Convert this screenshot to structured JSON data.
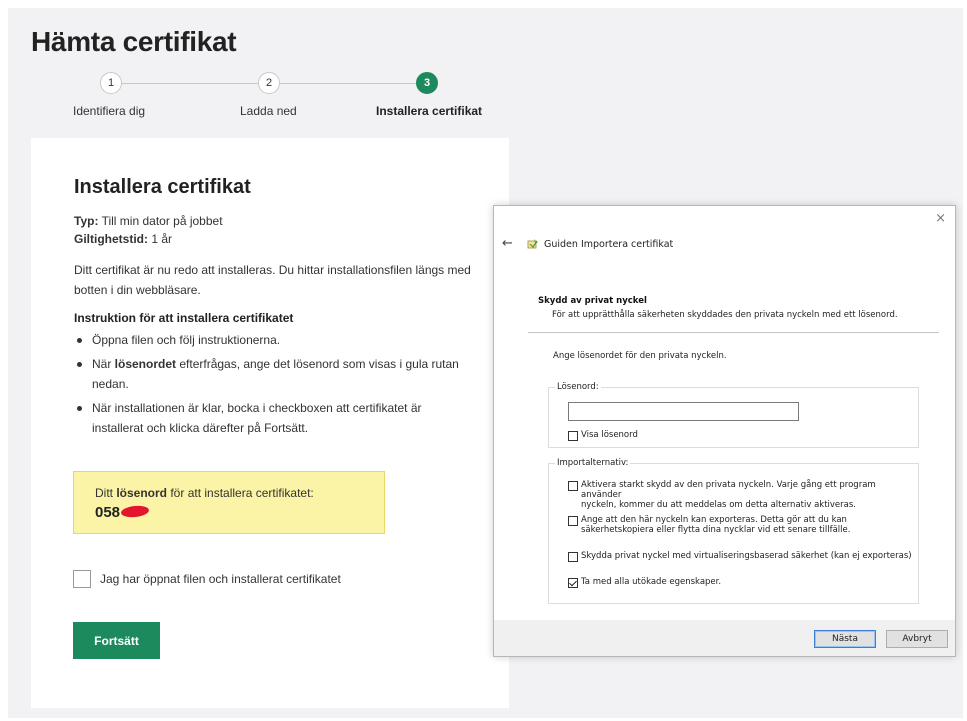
{
  "page": {
    "title": "Hämta certifikat"
  },
  "stepper": {
    "steps": [
      {
        "number": "1",
        "label": "Identifiera dig"
      },
      {
        "number": "2",
        "label": "Ladda ned"
      },
      {
        "number": "3",
        "label": "Installera certifikat"
      }
    ],
    "active_step": 3
  },
  "card": {
    "title": "Installera certifikat",
    "type_label": "Typ:",
    "type_value": "Till min dator på jobbet",
    "validity_label": "Giltighetstid:",
    "validity_value": "1 år",
    "description": "Ditt certifikat är nu redo att installeras. Du hittar installationsfilen längs med botten i din webbläsare.",
    "instructions_heading": "Instruktion för att installera certifikatet",
    "instruction_1": "Öppna filen och följ instruktionerna.",
    "instruction_2_pre": "När ",
    "instruction_2_bold": "lösenordet",
    "instruction_2_post": " efterfrågas, ange det lösenord som visas i gula rutan nedan.",
    "instruction_3": "När installationen är klar, bocka i checkboxen att certifikatet är installerat och klicka därefter på Fortsätt.",
    "password_pre": "Ditt ",
    "password_bold": "lösenord",
    "password_post": " för att installera certifikatet:",
    "password_value": "058",
    "confirm_label": "Jag har öppnat filen och installerat certifikatet",
    "confirm_checked": false,
    "continue_label": "Fortsätt"
  },
  "dialog": {
    "close_icon": "×",
    "back_icon": "←",
    "title": "Guiden Importera certifikat",
    "section_heading": "Skydd av privat nyckel",
    "section_subtitle": "För att upprätthålla säkerheten skyddades den privata nyckeln med ett lösenord.",
    "prompt": "Ange lösenordet för den privata nyckeln.",
    "password_group_label": "Lösenord:",
    "password_value": "",
    "show_password_label": "Visa lösenord",
    "show_password_checked": false,
    "import_group_label": "Importalternativ:",
    "option_1_line1": "Aktivera starkt skydd av den privata nyckeln. Varje gång ett program använder",
    "option_1_line2": "nyckeln, kommer du att meddelas om detta alternativ aktiveras.",
    "option_1_checked": false,
    "option_2_line1": "Ange att den här nyckeln kan exporteras. Detta gör att du kan",
    "option_2_line2": "säkerhetskopiera eller flytta dina nycklar vid ett senare tillfälle.",
    "option_2_checked": false,
    "option_3": "Skydda privat nyckel med virtualiseringsbaserad säkerhet (kan ej exporteras)",
    "option_3_checked": false,
    "option_4": "Ta med alla utökade egenskaper.",
    "option_4_checked": true,
    "next_label": "Nästa",
    "cancel_label": "Avbryt"
  },
  "colors": {
    "accent": "#1d8a5e",
    "password_box": "#fbf3a6",
    "redaction": "#e4162d"
  }
}
